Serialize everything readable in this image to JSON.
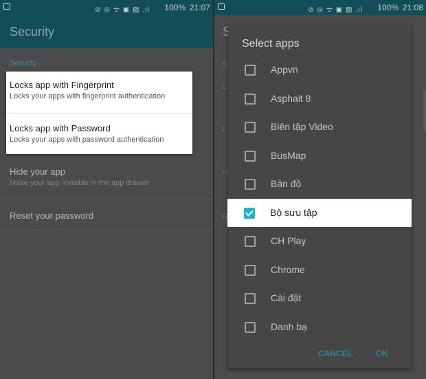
{
  "left": {
    "status": {
      "icons": "⊘ ◎ ᯤ ▣ ▨ .ıl",
      "battery": "100%",
      "time": "21:07"
    },
    "appbar_title": "Security",
    "section_header": "Security",
    "items": [
      {
        "title": "Locks app with Fingerprint",
        "subtitle": "Locks your apps with fingerprint authentication"
      },
      {
        "title": "Locks app with Password",
        "subtitle": "Locks your apps with password authentication"
      },
      {
        "title": "Hide your app",
        "subtitle": "Make your app invisible in the app drawer"
      },
      {
        "title": "Reset your password",
        "subtitle": ""
      }
    ]
  },
  "right": {
    "status": {
      "icons": "⊘ ◎ ᯤ ▣ ▨ .ıl",
      "battery": "100%",
      "time": "21:08"
    },
    "dim_title": "S",
    "side_letters": [
      "S",
      "L",
      "L",
      "H",
      "R"
    ],
    "dialog": {
      "title": "Select apps",
      "apps": [
        {
          "label": "Appvn",
          "checked": false
        },
        {
          "label": "Asphalt 8",
          "checked": false
        },
        {
          "label": "Biên tập Video",
          "checked": false
        },
        {
          "label": "BusMap",
          "checked": false
        },
        {
          "label": "Bản đồ",
          "checked": false
        },
        {
          "label": "Bộ sưu tập",
          "checked": true
        },
        {
          "label": "CH Play",
          "checked": false
        },
        {
          "label": "Chrome",
          "checked": false
        },
        {
          "label": "Cài đặt",
          "checked": false
        },
        {
          "label": "Danh bạ",
          "checked": false
        }
      ],
      "cancel_label": "CANCEL",
      "ok_label": "OK"
    }
  },
  "colors": {
    "toolbar": "#114e57",
    "accent": "#19b7cf",
    "dialog_button": "#2a8791",
    "dimmed_background": "#4b4b4b"
  }
}
